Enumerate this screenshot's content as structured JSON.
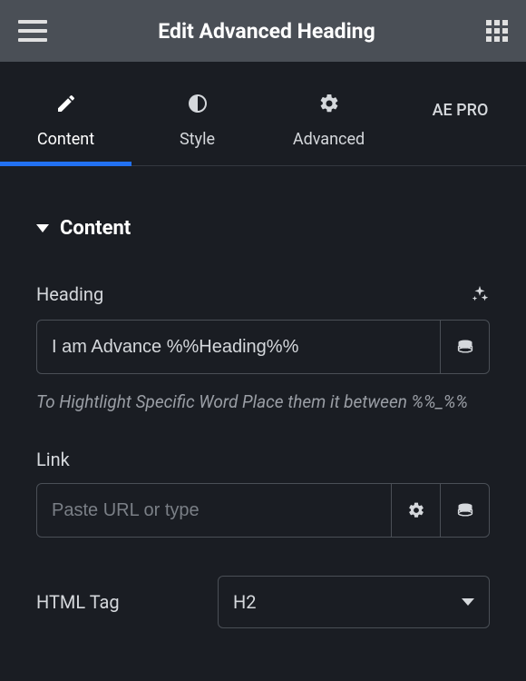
{
  "header": {
    "title": "Edit Advanced Heading"
  },
  "tabs": {
    "content": "Content",
    "style": "Style",
    "advanced": "Advanced",
    "aepro": "AE PRO"
  },
  "section": {
    "title": "Content"
  },
  "heading": {
    "label": "Heading",
    "value": "I am Advance %%Heading%%",
    "hint": "To Hightlight Specific Word Place them it between %%_%%"
  },
  "link": {
    "label": "Link",
    "placeholder": "Paste URL or type"
  },
  "htmltag": {
    "label": "HTML Tag",
    "value": "H2"
  }
}
